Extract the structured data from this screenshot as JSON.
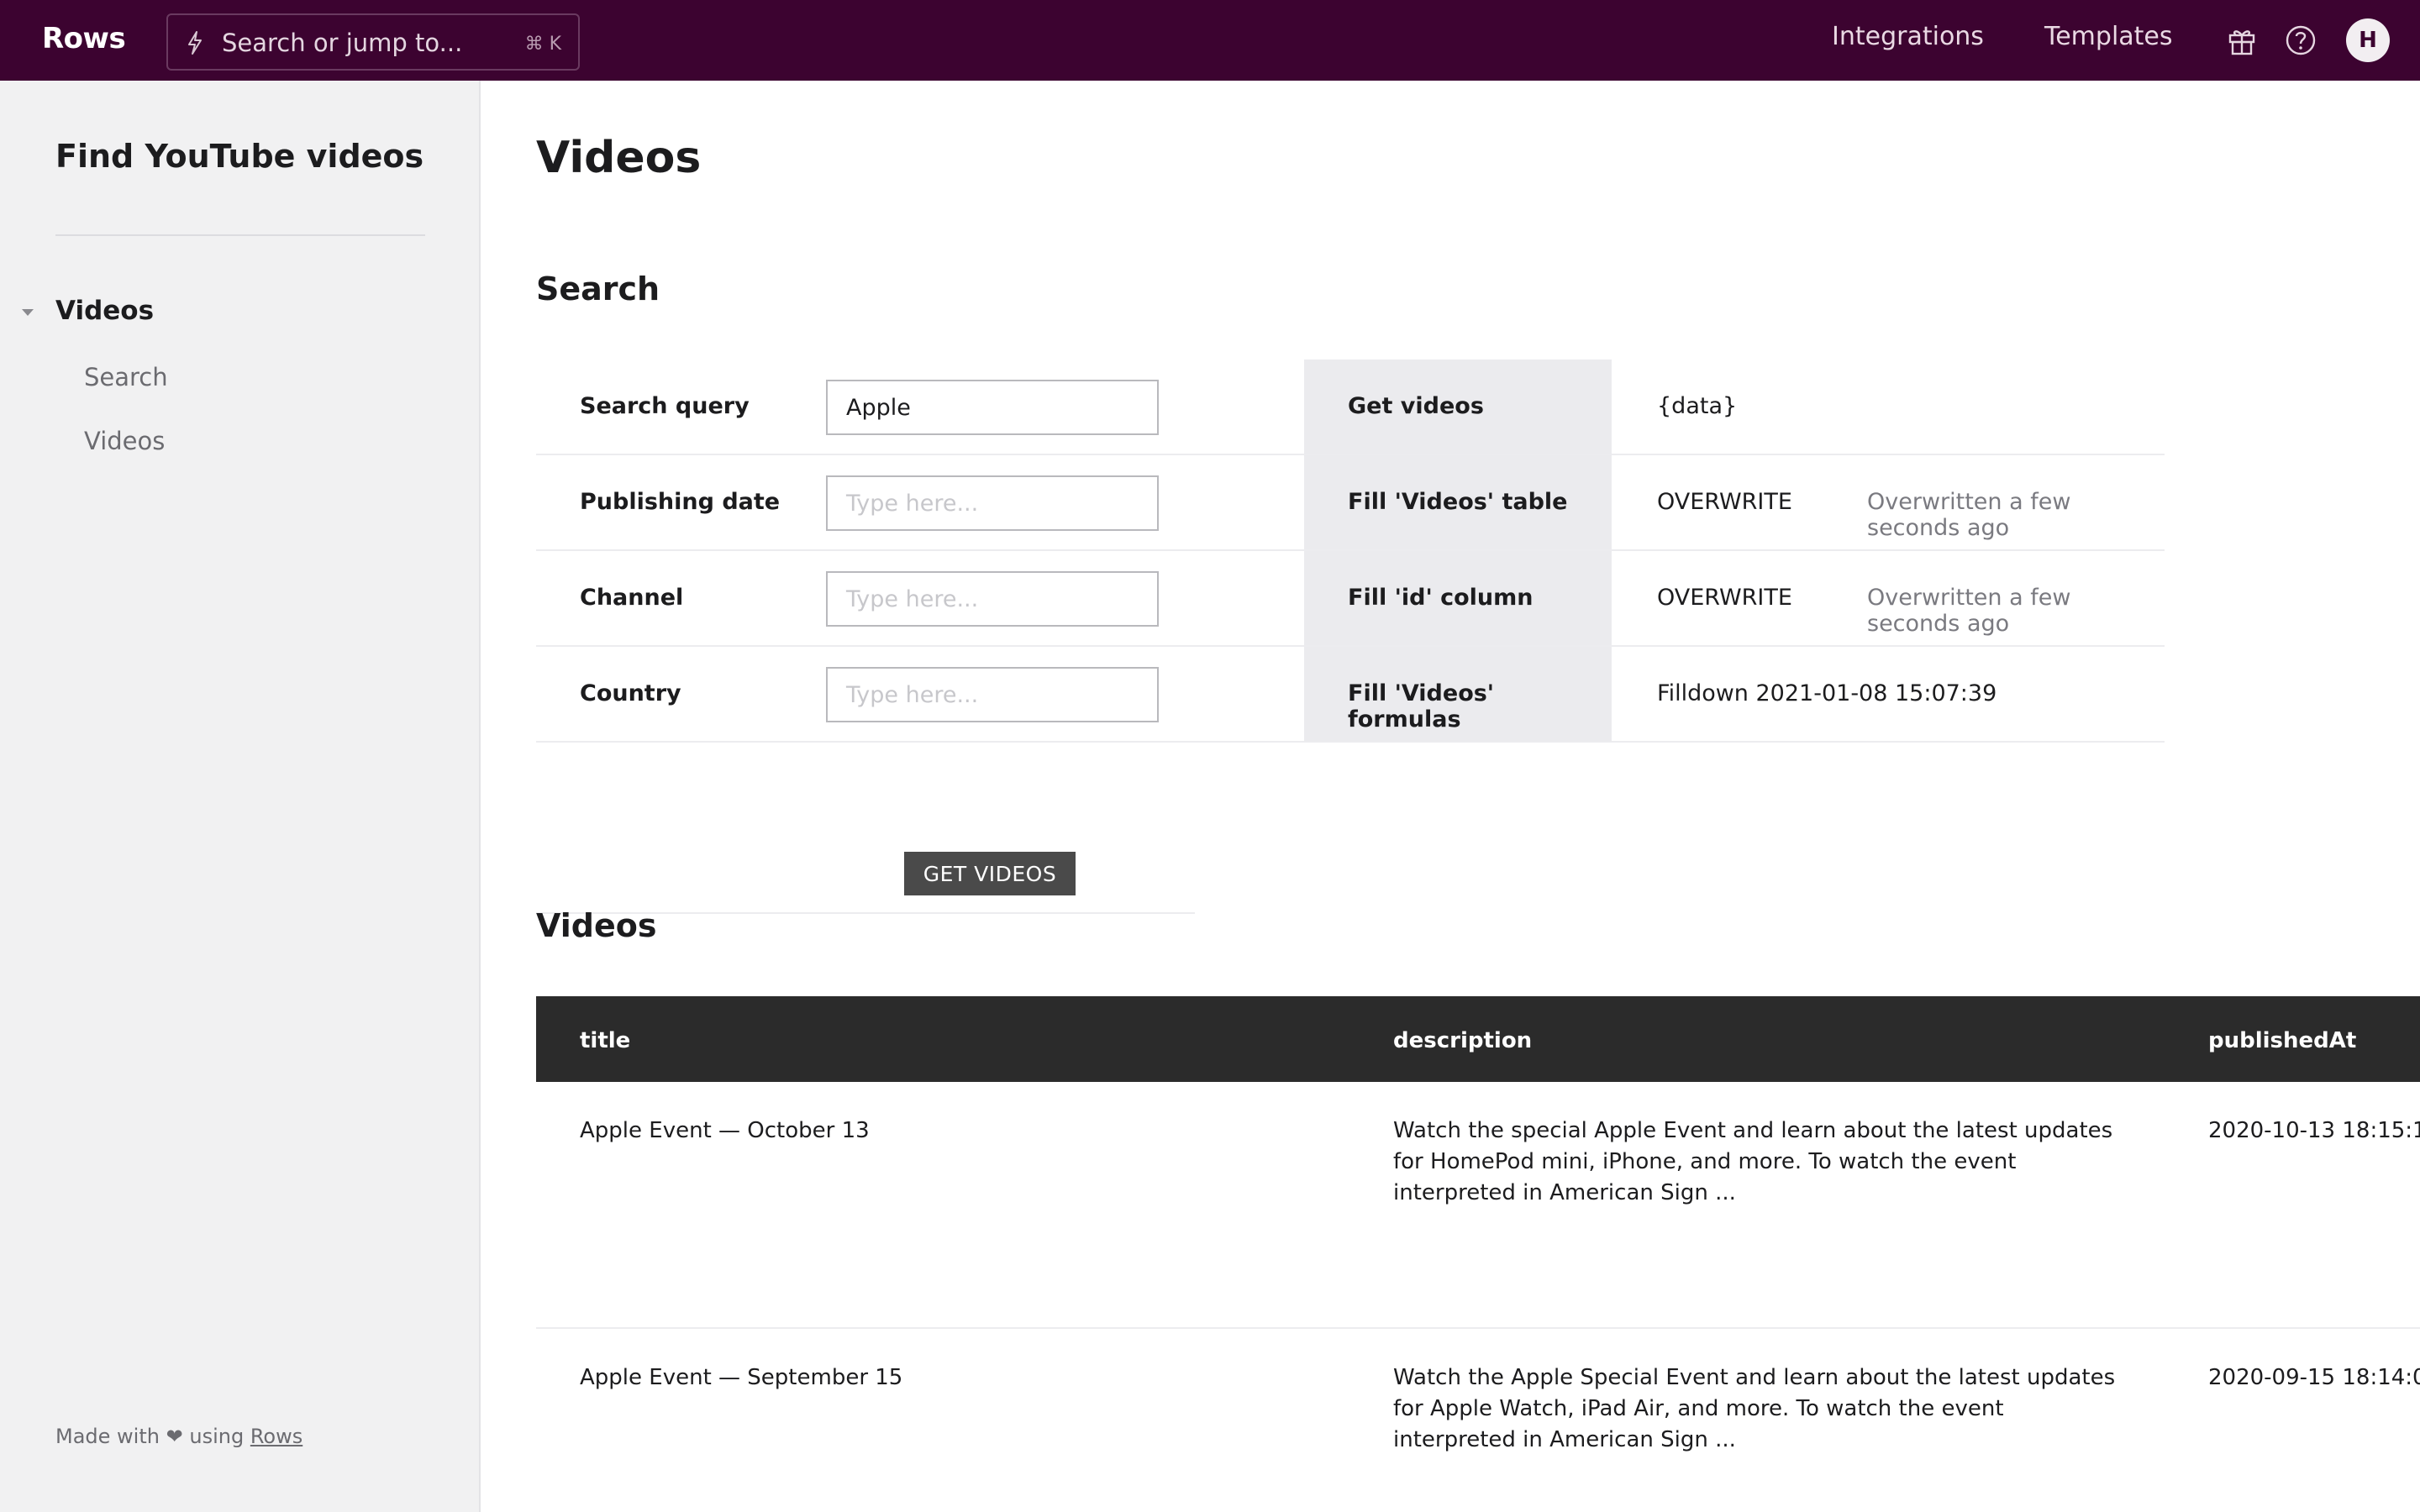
{
  "topbar": {
    "logo": "Rows",
    "search_placeholder": "Search or jump to...",
    "search_shortcut": "⌘ K",
    "nav": [
      "Integrations",
      "Templates"
    ],
    "avatar_initial": "H",
    "background": "#3c0330"
  },
  "sidebar": {
    "title": "Find YouTube videos",
    "group": "Videos",
    "items": [
      "Search",
      "Videos"
    ],
    "footer": {
      "prefix": "Made with",
      "heart": "❤",
      "middle": "using",
      "link": "Rows"
    }
  },
  "main": {
    "page_title": "Videos",
    "search_section": {
      "title": "Search",
      "fields": [
        {
          "label": "Search query",
          "value": "Apple",
          "placeholder": ""
        },
        {
          "label": "Publishing date",
          "value": "",
          "placeholder": "Type here..."
        },
        {
          "label": "Channel",
          "value": "",
          "placeholder": "Type here..."
        },
        {
          "label": "Country",
          "value": "",
          "placeholder": "Type here..."
        }
      ],
      "actions": [
        {
          "label": "Get videos",
          "value": "{data}",
          "note": ""
        },
        {
          "label": "Fill 'Videos' table",
          "value": "OVERWRITE",
          "note": "Overwritten a few seconds ago"
        },
        {
          "label": "Fill 'id' column",
          "value": "OVERWRITE",
          "note": "Overwritten a few seconds ago"
        },
        {
          "label": "Fill 'Videos' formulas",
          "value": "Filldown 2021-01-08 15:07:39",
          "note": ""
        }
      ],
      "button": "GET VIDEOS"
    },
    "videos_section": {
      "title": "Videos",
      "columns": [
        "title",
        "description",
        "publishedAt"
      ],
      "rows": [
        {
          "title": "Apple Event — October 13",
          "description": "Watch the special Apple Event and learn about the latest updates for HomePod mini, iPhone, and more. To watch the event interpreted in American Sign ...",
          "publishedAt": "2020-10-13 18:15:1"
        },
        {
          "title": "Apple Event — September 15",
          "description": "Watch the Apple Special Event and learn about the latest updates for Apple Watch, iPad Air, and more. To watch the event interpreted in American Sign ...",
          "publishedAt": "2020-09-15 18:14:0"
        }
      ]
    }
  }
}
